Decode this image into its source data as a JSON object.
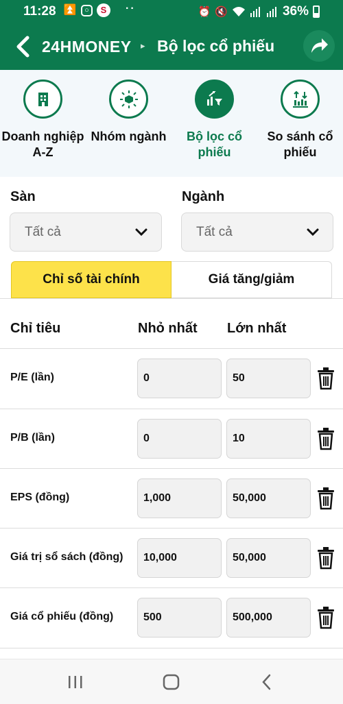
{
  "status_bar": {
    "time": "11:28",
    "battery": "36%",
    "dots": "··"
  },
  "header": {
    "brand": "24HMONEY",
    "separator": "▸",
    "title": "Bộ lọc cổ phiếu"
  },
  "quick_menu": [
    {
      "label": "Doanh nghiệp A-Z",
      "icon": "building-icon",
      "active": false
    },
    {
      "label": "Nhóm ngành",
      "icon": "cube-network-icon",
      "active": false
    },
    {
      "label": "Bộ lọc cổ phiếu",
      "icon": "filter-chart-icon",
      "active": true
    },
    {
      "label": "So sánh cổ phiếu",
      "icon": "compare-chart-icon",
      "active": false
    }
  ],
  "filters": {
    "exchange": {
      "label": "Sàn",
      "value": "Tất cả"
    },
    "industry": {
      "label": "Ngành",
      "value": "Tất cả"
    }
  },
  "tabs": {
    "financial": "Chỉ số tài chính",
    "price_change": "Giá tăng/giảm",
    "active": "financial"
  },
  "table": {
    "headers": {
      "criteria": "Chỉ tiêu",
      "min": "Nhỏ nhất",
      "max": "Lớn nhất"
    },
    "rows": [
      {
        "name": "P/E (lần)",
        "min": "0",
        "max": "50"
      },
      {
        "name": "P/B (lần)",
        "min": "0",
        "max": "10"
      },
      {
        "name": "EPS (đồng)",
        "min": "1,000",
        "max": "50,000"
      },
      {
        "name": "Giá trị sổ sách (đồng)",
        "min": "10,000",
        "max": "50,000"
      },
      {
        "name": "Giá cổ phiếu (đồng)",
        "min": "500",
        "max": "500,000"
      }
    ]
  },
  "colors": {
    "brand_green": "#0c7a4e",
    "tab_active": "#fde24a",
    "quick_bg": "#f3f8fb"
  }
}
